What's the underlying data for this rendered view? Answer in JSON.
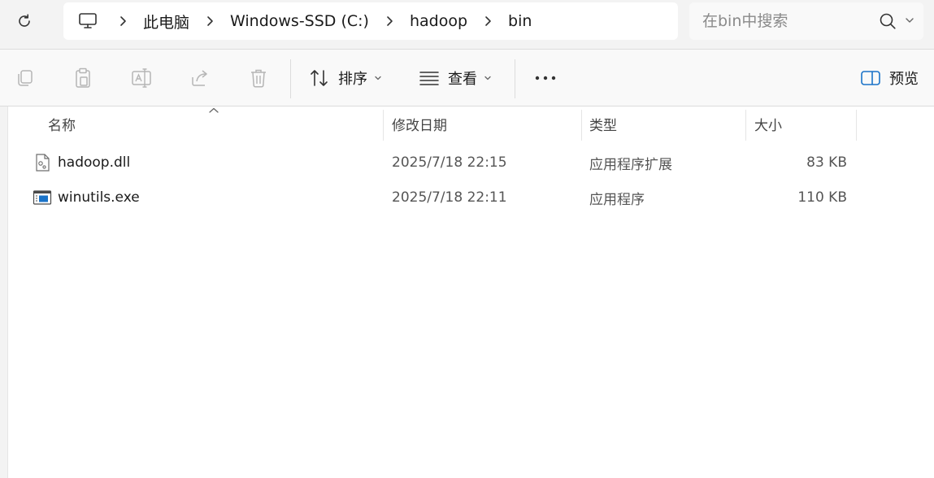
{
  "breadcrumb": {
    "items": [
      "此电脑",
      "Windows-SSD (C:)",
      "hadoop",
      "bin"
    ]
  },
  "search": {
    "placeholder": "在bin中搜索"
  },
  "toolbar": {
    "sort_label": "排序",
    "view_label": "查看",
    "preview_label": "预览"
  },
  "columns": {
    "name": "名称",
    "date": "修改日期",
    "type": "类型",
    "size": "大小"
  },
  "files": [
    {
      "name": "hadoop.dll",
      "date": "2025/7/18 22:15",
      "type": "应用程序扩展",
      "size": "83 KB",
      "icon": "dll-file-icon"
    },
    {
      "name": "winutils.exe",
      "date": "2025/7/18 22:11",
      "type": "应用程序",
      "size": "110 KB",
      "icon": "exe-file-icon"
    }
  ],
  "colors": {
    "accent": "#1a73c8",
    "window_bg": "#f3f3f3",
    "content_bg": "#ffffff"
  }
}
